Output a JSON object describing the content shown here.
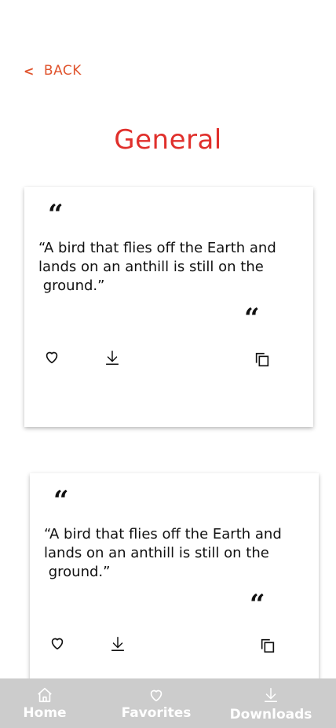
{
  "header": {
    "back_chevron": "<",
    "back_label": "BACK",
    "page_title": "General"
  },
  "quotes": [
    {
      "open_mark": "“",
      "text": "“A bird that flies off the Earth and lands on an anthill is still on the\n ground.”",
      "close_mark": "“"
    },
    {
      "open_mark": "“",
      "text": "“A bird that flies off the Earth and lands on an anthill is still on the\n ground.”",
      "close_mark": "“"
    }
  ],
  "card_actions": {
    "favorite_icon": "heart-icon",
    "download_icon": "download-icon",
    "copy_icon": "copy-icon"
  },
  "tabbar": {
    "home": "Home",
    "favorites": "Favorites",
    "downloads": "Downloads"
  },
  "colors": {
    "accent": "#e0542e",
    "title": "#e0302c",
    "tabbar_bg": "#cccccc",
    "tabbar_text": "#ffffff"
  }
}
